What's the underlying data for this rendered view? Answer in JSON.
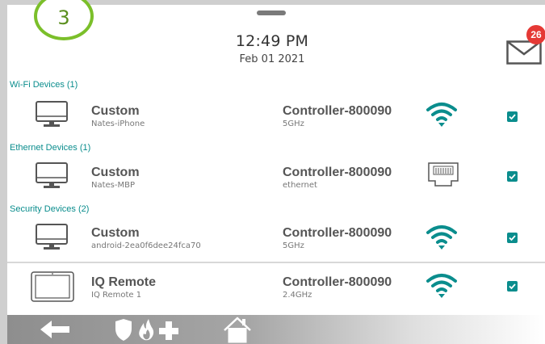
{
  "status": {
    "badge_number": "3",
    "time": "12:49 PM",
    "date": "Feb 01 2021",
    "mail_count": "26"
  },
  "sections": {
    "wifi": "Wi-Fi Devices (1)",
    "ethernet": "Ethernet Devices (1)",
    "security": "Security Devices (2)"
  },
  "devices": [
    {
      "type_label": "Custom",
      "name": "Nates-iPhone",
      "controller": "Controller-800090",
      "connection": "5GHz",
      "icon": "monitor-icon",
      "signal_icon": "wifi-icon",
      "checked": true
    },
    {
      "type_label": "Custom",
      "name": "Nates-MBP",
      "controller": "Controller-800090",
      "connection": "ethernet",
      "icon": "monitor-icon",
      "signal_icon": "ethernet-port-icon",
      "checked": true
    },
    {
      "type_label": "Custom",
      "name": "android-2ea0f6dee24fca70",
      "controller": "Controller-800090",
      "connection": "5GHz",
      "icon": "monitor-icon",
      "signal_icon": "wifi-icon",
      "checked": true
    },
    {
      "type_label": "IQ Remote",
      "name": "IQ Remote 1",
      "controller": "Controller-800090",
      "connection": "2.4GHz",
      "icon": "tablet-icon",
      "signal_icon": "wifi-icon",
      "checked": true
    }
  ],
  "bottom_nav": [
    "back-arrow-icon",
    "emergency-icon",
    "home-icon"
  ],
  "colors": {
    "accent": "#0a8d8d",
    "badge_ring": "#7bbf2a",
    "alert": "#e53935"
  }
}
